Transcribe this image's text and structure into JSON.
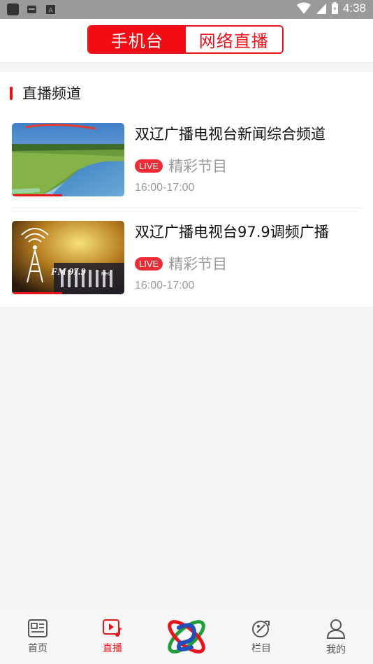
{
  "status_bar": {
    "time": "4:38"
  },
  "header": {
    "tabs": [
      {
        "label": "手机台",
        "active": true
      },
      {
        "label": "网络直播",
        "active": false
      }
    ]
  },
  "section": {
    "title": "直播频道",
    "channels": [
      {
        "name": "双辽广播电视台新闻综合频道",
        "live": "LIVE",
        "program": "精彩节目",
        "time": "16:00-17:00",
        "thumbnail": "river-landscape-image",
        "progress": 0.45
      },
      {
        "name": "双辽广播电视台97.9调频广播",
        "live": "LIVE",
        "program": "精彩节目",
        "time": "16:00-17:00",
        "thumbnail": "fm-radio-tower-image",
        "thumb_text": "FM 97.9",
        "thumb_unit": "MHz",
        "progress": 0.45
      }
    ]
  },
  "bottom_nav": {
    "items": [
      {
        "label": "首页",
        "icon": "news-icon",
        "active": false
      },
      {
        "label": "直播",
        "icon": "live-play-icon",
        "active": true
      },
      {
        "label": "",
        "icon": "station-logo",
        "active": false
      },
      {
        "label": "栏目",
        "icon": "column-icon",
        "active": false
      },
      {
        "label": "我的",
        "icon": "user-icon",
        "active": false
      }
    ]
  },
  "colors": {
    "accent": "#f20c14",
    "live_badge": "#ef2b35"
  }
}
